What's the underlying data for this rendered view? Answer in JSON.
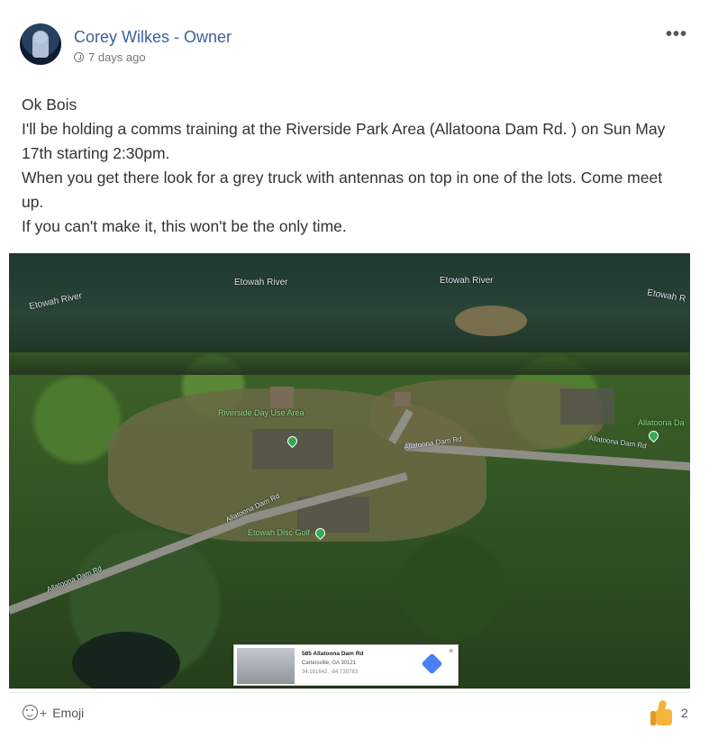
{
  "post": {
    "author": "Corey Wilkes - Owner",
    "timestamp": "7 days ago",
    "more_label": "•••",
    "body_lines": [
      "Ok Bois",
      "I'll be holding a comms training at the Riverside Park Area (Allatoona Dam Rd. ) on Sun May 17th starting 2:30pm.",
      "When you get there look for a grey truck with antennas on top in one of the lots. Come meet up.",
      "If you can't make it, this won't be the only time."
    ]
  },
  "map": {
    "labels": {
      "river1": "Etowah River",
      "river2": "Etowah River",
      "river3": "Etowah River",
      "river4": "Etowah R",
      "day_use": "Riverside Day Use Area",
      "disc_golf": "Etowah Disc Golf",
      "allatoona": "Allatoona Da",
      "road1": "Allatoona Dam Rd",
      "road2": "Allatoona Dam Rd",
      "road3": "Allatoona Dam Rd",
      "road4": "Allatoona Dam Rd"
    },
    "info_card": {
      "address": "585 Allatoona Dam Rd",
      "city": "Cartersville, GA 30121",
      "coords": "34.161642, -84.739783",
      "close": "×"
    }
  },
  "footer": {
    "emoji_plus": "+",
    "emoji_label": "Emoji",
    "like_count": "2"
  },
  "colors": {
    "author": "#3d5f9e",
    "like": "#f5b43b",
    "directions": "#4a80f5"
  }
}
